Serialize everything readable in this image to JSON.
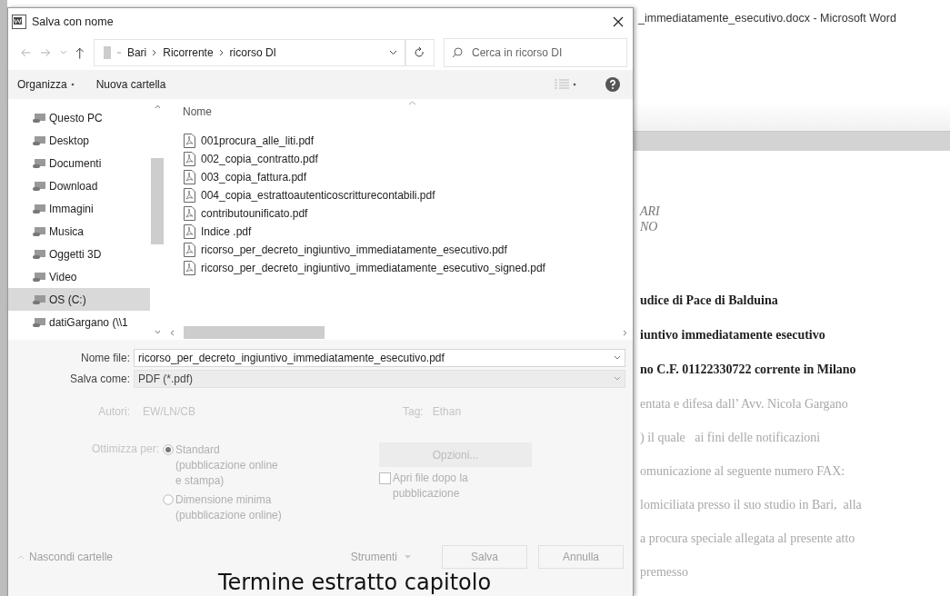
{
  "word": {
    "title": "_immediatamente_esecutivo.docx - Microsoft Word",
    "document_lines": [
      {
        "kind": "italic",
        "text": "ARI"
      },
      {
        "kind": "italic",
        "text": "NO"
      },
      {
        "kind": "bold",
        "text": "udice di Pace di Balduina"
      },
      {
        "kind": "bold",
        "text": "iuntivo immediatamente esecutivo"
      },
      {
        "kind": "bold",
        "text": "no C.F. 01122330722 corrente in Milano"
      },
      {
        "kind": "faded",
        "text": "entata e difesa dall’ Avv. Nicola Gargano"
      },
      {
        "kind": "faded",
        "text": ") il quale   ai fini delle notificazioni"
      },
      {
        "kind": "faded",
        "text": "omunicazione al seguente numero FAX:"
      },
      {
        "kind": "faded",
        "text": "lomiciliata presso il suo studio in Bari,  alla"
      },
      {
        "kind": "faded",
        "text": "a procura speciale allegata al presente atto"
      },
      {
        "kind": "faded",
        "text": "premesso"
      }
    ]
  },
  "dialog": {
    "title": "Salva con nome",
    "path": [
      "Bari",
      "Ricorrente",
      "ricorso DI"
    ],
    "search": {
      "placeholder": "Cerca in ricorso DI"
    },
    "toolbar": {
      "organize": "Organizza",
      "new_folder": "Nuova cartella"
    },
    "sidebar": {
      "items": [
        {
          "label": "Questo PC",
          "selected": false
        },
        {
          "label": "Desktop",
          "selected": false
        },
        {
          "label": "Documenti",
          "selected": false
        },
        {
          "label": "Download",
          "selected": false
        },
        {
          "label": "Immagini",
          "selected": false
        },
        {
          "label": "Musica",
          "selected": false
        },
        {
          "label": "Oggetti 3D",
          "selected": false
        },
        {
          "label": "Video",
          "selected": false
        },
        {
          "label": "OS (C:)",
          "selected": true
        },
        {
          "label": "datiGargano (\\\\1",
          "selected": false
        }
      ]
    },
    "column": "Nome",
    "files": [
      "001procura_alle_liti.pdf",
      "002_copia_contratto.pdf",
      "003_copia_fattura.pdf",
      "004_copia_estrattoautenticoscritturecontabili.pdf",
      "contributounificato.pdf",
      "Indice .pdf",
      "ricorso_per_decreto_ingiuntivo_immediatamente_esecutivo.pdf",
      "ricorso_per_decreto_ingiuntivo_immediatamente_esecutivo_signed.pdf"
    ],
    "file_name": {
      "label": "Nome file:",
      "value": "ricorso_per_decreto_ingiuntivo_immediatamente_esecutivo.pdf"
    },
    "save_as": {
      "label": "Salva come:",
      "value": "PDF (*.pdf)"
    },
    "authors": {
      "label": "Autori:",
      "value": "EW/LN/CB"
    },
    "tags": {
      "label": "Tag:",
      "value": "Ethan"
    },
    "optimize": {
      "label": "Ottimizza per:",
      "options": [
        {
          "label": "Standard (pubblicazione online e stampa)",
          "selected": true
        },
        {
          "label": "Dimensione minima (pubblicazione online)",
          "selected": false
        }
      ]
    },
    "options_button": "Opzioni...",
    "open_after": {
      "label": "Apri file dopo la pubblicazione",
      "checked": false
    },
    "hide_folders": "Nascondi cartelle",
    "tools": "Strumenti",
    "save": "Salva",
    "cancel": "Annulla"
  },
  "caption": "Termine estratto capitolo"
}
